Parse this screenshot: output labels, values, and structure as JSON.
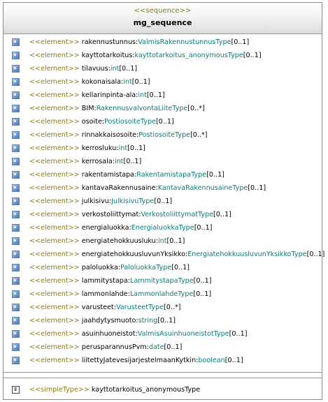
{
  "sequence": {
    "stereotype": "<<sequence>>",
    "name": "mg_sequence",
    "elements": [
      {
        "stereotype": "<<element>>",
        "name": "rakennustunnus",
        "type": "ValmisRakennustunnusType",
        "multiplicity": "[0..1]"
      },
      {
        "stereotype": "<<element>>",
        "name": "kayttotarkoitus",
        "type": "kayttotarkoitus_anonymousType",
        "multiplicity": "[0..1]"
      },
      {
        "stereotype": "<<element>>",
        "name": "tilavuus",
        "type": "int",
        "multiplicity": "[0..1]"
      },
      {
        "stereotype": "<<element>>",
        "name": "kokonaisala",
        "type": "int",
        "multiplicity": "[0..1]"
      },
      {
        "stereotype": "<<element>>",
        "name": "kellarinpinta-ala",
        "type": "int",
        "multiplicity": "[0..1]"
      },
      {
        "stereotype": "<<element>>",
        "name": "BIM",
        "type": "RakennusvalvontaLiiteType",
        "multiplicity": "[0..*]"
      },
      {
        "stereotype": "<<element>>",
        "name": "osoite",
        "type": "PostiosoiteType",
        "multiplicity": "[0..1]"
      },
      {
        "stereotype": "<<element>>",
        "name": "rinnakkaisosoite",
        "type": "PostiosoiteType",
        "multiplicity": "[0..*]"
      },
      {
        "stereotype": "<<element>>",
        "name": "kerrosluku",
        "type": "int",
        "multiplicity": "[0..1]"
      },
      {
        "stereotype": "<<element>>",
        "name": "kerrosala",
        "type": "int",
        "multiplicity": "[0..1]"
      },
      {
        "stereotype": "<<element>>",
        "name": "rakentamistapa",
        "type": "RakentamistapaType",
        "multiplicity": "[0..1]"
      },
      {
        "stereotype": "<<element>>",
        "name": "kantavaRakennusaine",
        "type": "KantavaRakennusaineType",
        "multiplicity": "[0..1]"
      },
      {
        "stereotype": "<<element>>",
        "name": "julkisivu",
        "type": "JulkisivuType",
        "multiplicity": "[0..1]"
      },
      {
        "stereotype": "<<element>>",
        "name": "verkostoliittymat",
        "type": "VerkostoliittymatType",
        "multiplicity": "[0..1]"
      },
      {
        "stereotype": "<<element>>",
        "name": "energialuokka",
        "type": "EnergialuokkaType",
        "multiplicity": "[0..1]"
      },
      {
        "stereotype": "<<element>>",
        "name": "energiatehokkuusluku",
        "type": "int",
        "multiplicity": "[0..1]"
      },
      {
        "stereotype": "<<element>>",
        "name": "energiatehokkuusluvunYksikko",
        "type": "EnergiatehokkuusluvunYksikkoType",
        "multiplicity": "[0..1]"
      },
      {
        "stereotype": "<<element>>",
        "name": "paloluokka",
        "type": "PaloluokkaType",
        "multiplicity": "[0..1]"
      },
      {
        "stereotype": "<<element>>",
        "name": "lammitystapa",
        "type": "LammitystapaType",
        "multiplicity": "[0..1]"
      },
      {
        "stereotype": "<<element>>",
        "name": "lammonlahde",
        "type": "LammonlahdeType",
        "multiplicity": "[0..1]"
      },
      {
        "stereotype": "<<element>>",
        "name": "varusteet",
        "type": "VarusteetType",
        "multiplicity": "[0..*]"
      },
      {
        "stereotype": "<<element>>",
        "name": "jaahdytysmuoto",
        "type": "string",
        "multiplicity": "[0..1]"
      },
      {
        "stereotype": "<<element>>",
        "name": "asuinhuoneistot",
        "type": "ValmisAsuinhuoneistotType",
        "multiplicity": "[0..1]"
      },
      {
        "stereotype": "<<element>>",
        "name": "perusparannusPvm",
        "type": "date",
        "multiplicity": "[0..1]"
      },
      {
        "stereotype": "<<element>>",
        "name": "liitettyJatevesijarjestelmaanKytkin",
        "type": "boolean",
        "multiplicity": "[0..1]"
      }
    ],
    "simple_type": {
      "icon_letter": "E",
      "stereotype": "<<simpleType>>",
      "name": "kayttotarkoitus_anonymousType"
    }
  }
}
